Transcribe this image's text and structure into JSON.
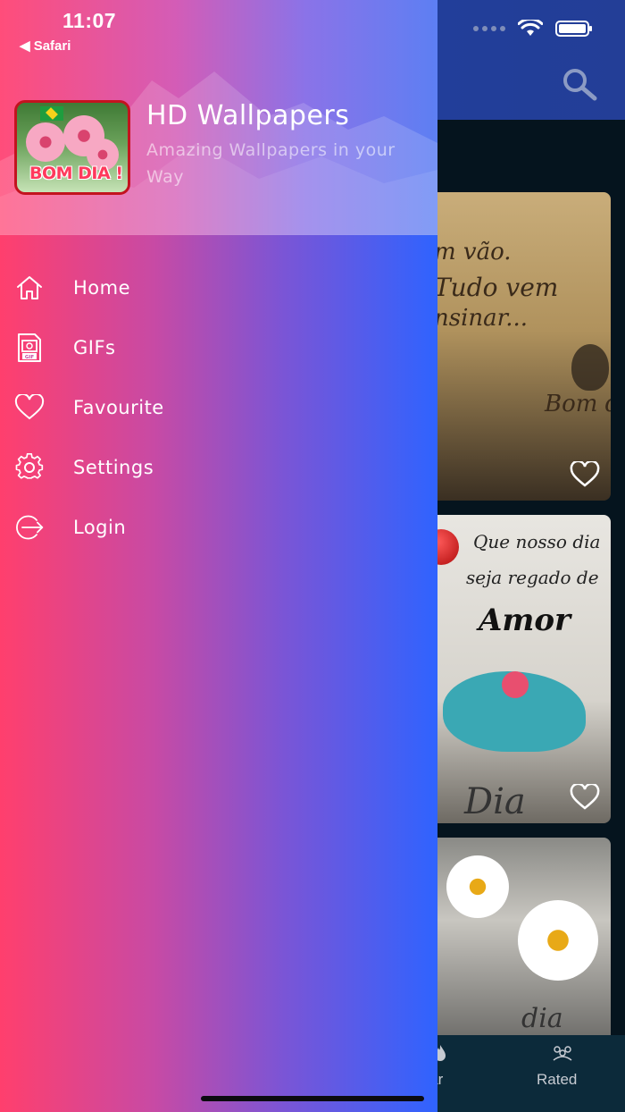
{
  "status_bar": {
    "time": "11:07",
    "back_label": "◀ Safari"
  },
  "drawer": {
    "app_title": "HD Wallpapers",
    "app_subtitle": "Amazing Wallpapers in your Way",
    "logo_text": "BOM DIA !",
    "menu": [
      {
        "label": "Home",
        "icon": "home-icon"
      },
      {
        "label": "GIFs",
        "icon": "gif-file-icon"
      },
      {
        "label": "Favourite",
        "icon": "heart-icon"
      },
      {
        "label": "Settings",
        "icon": "gear-icon"
      },
      {
        "label": "Login",
        "icon": "login-icon"
      }
    ]
  },
  "background_app": {
    "cards": [
      {
        "lines": [
          "m vão.",
          "Tudo vem",
          "nsinar...",
          "Bom d"
        ]
      },
      {
        "lines": [
          "Que nosso dia",
          "seja regado de",
          "Amor",
          "Dia"
        ]
      },
      {
        "lines": [
          "dia"
        ]
      }
    ],
    "bottom_nav": {
      "popular_label": "ular",
      "rated_label": "Rated"
    }
  },
  "colors": {
    "drawer_gradient_start": "#ff3f6d",
    "drawer_gradient_end": "#2f63ff",
    "appbar": "#1f3fa0",
    "bottom_nav": "#0c2a3a"
  }
}
